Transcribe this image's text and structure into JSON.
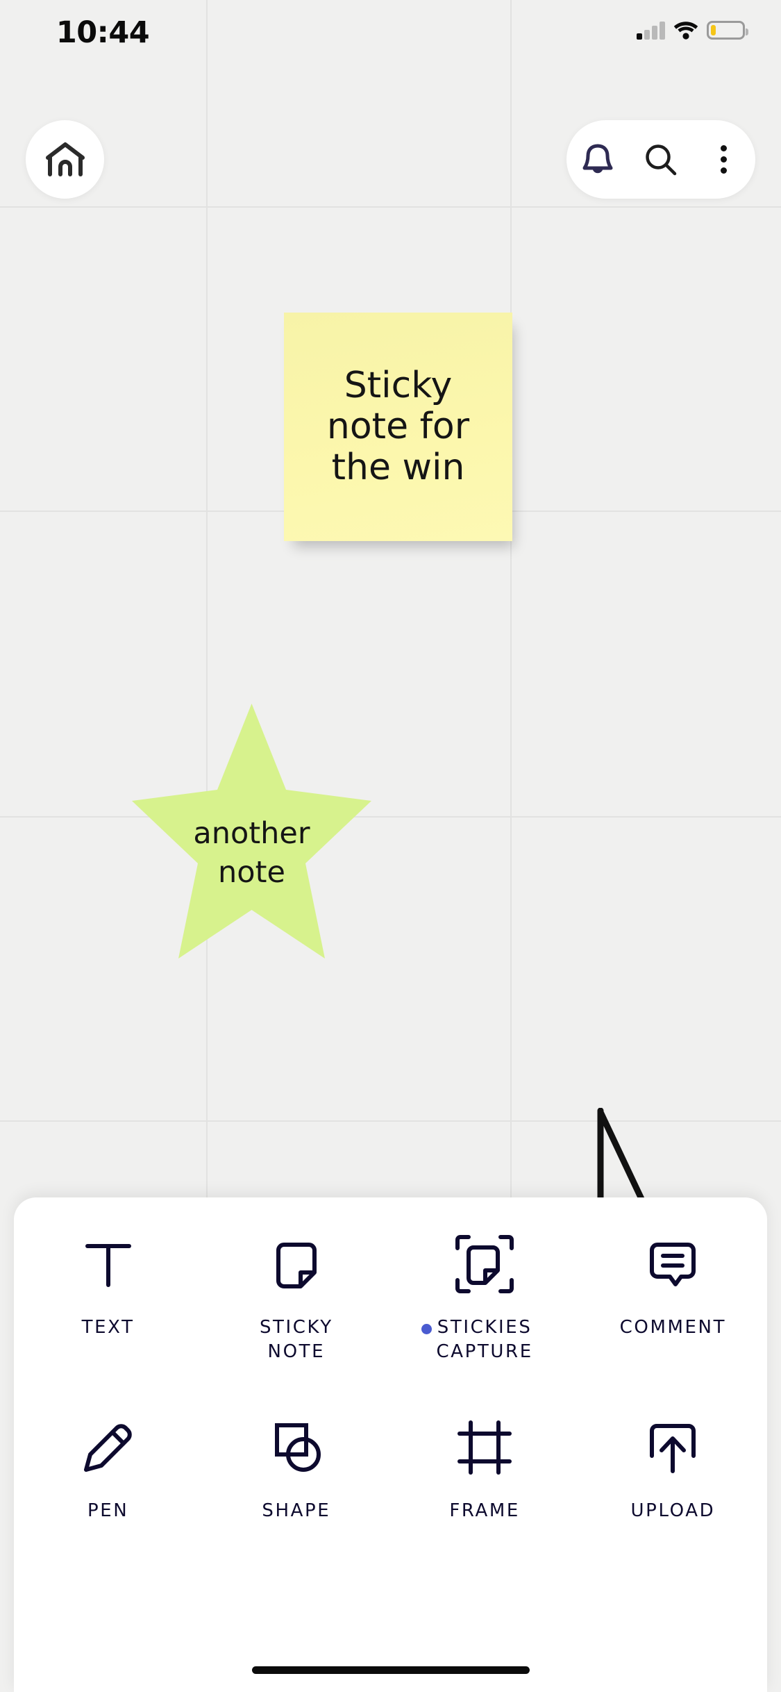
{
  "status_bar": {
    "time": "10:44",
    "signal_icon": "cellular-bars-icon",
    "wifi_icon": "wifi-icon",
    "battery_icon": "battery-low-icon",
    "battery_color": "#f5c518"
  },
  "top_bar": {
    "home_icon": "home-icon",
    "actions": [
      {
        "name": "notifications-button",
        "icon": "bell-icon",
        "color": "#2e2a52"
      },
      {
        "name": "search-button",
        "icon": "search-icon",
        "color": "#1d1d1d"
      },
      {
        "name": "more-options-button",
        "icon": "kebab-menu-icon",
        "color": "#111111"
      }
    ]
  },
  "canvas": {
    "background_color": "#f0f0ef",
    "grid_color": "#e2e2e1",
    "vertical_gridlines": [
      297,
      735
    ],
    "horizontal_gridlines": [
      297,
      735,
      1175,
      1613
    ],
    "objects": {
      "sticky_note": {
        "text": "Sticky\nnote for\nthe win",
        "color": "#fbf6ad",
        "text_color": "#151515"
      },
      "star": {
        "text": "another\nnote",
        "color": "#d7f28d",
        "text_color": "#151515"
      },
      "ink_stroke": {
        "color": "#111111"
      }
    }
  },
  "tool_sheet": {
    "tools": [
      {
        "label": "TEXT",
        "icon": "text-tool-icon",
        "badge": false
      },
      {
        "label": "STICKY\nNOTE",
        "icon": "sticky-note-tool-icon",
        "badge": false
      },
      {
        "label": "STICKIES\nCAPTURE",
        "icon": "stickies-capture-tool-icon",
        "badge": true,
        "badge_color": "#4a5bd0"
      },
      {
        "label": "COMMENT",
        "icon": "comment-tool-icon",
        "badge": false
      },
      {
        "label": "PEN",
        "icon": "pen-tool-icon",
        "badge": false
      },
      {
        "label": "SHAPE",
        "icon": "shape-tool-icon",
        "badge": false
      },
      {
        "label": "FRAME",
        "icon": "frame-tool-icon",
        "badge": false
      },
      {
        "label": "UPLOAD",
        "icon": "upload-tool-icon",
        "badge": false
      }
    ],
    "icon_color": "#0d0a2e"
  }
}
